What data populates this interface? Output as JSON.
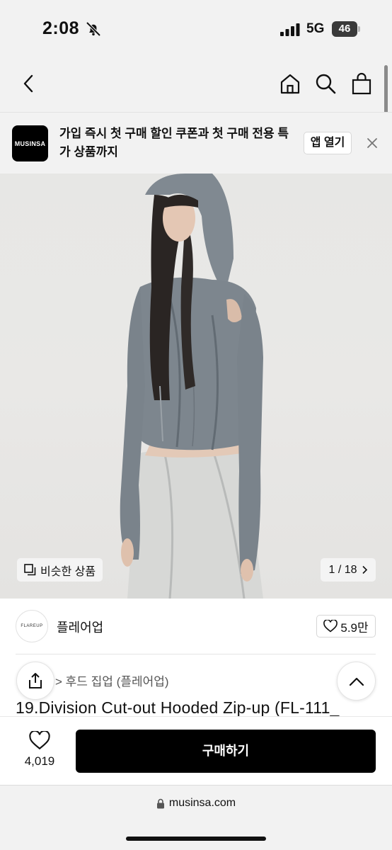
{
  "status_bar": {
    "time": "2:08",
    "network": "5G",
    "battery": "46"
  },
  "header": {
    "back_icon": "chevron-left-icon",
    "home_icon": "home-icon",
    "search_icon": "search-icon",
    "cart_icon": "shopping-bag-icon"
  },
  "app_banner": {
    "logo_text": "MUSINSA",
    "message": "가입 즉시 첫 구매 할인 쿠폰과 첫 구매 전용 특가 상품까지",
    "open_app_label": "앱 열기"
  },
  "gallery": {
    "similar_label": "비슷한 상품",
    "page_current": "1",
    "page_total": "18",
    "page_label": "1 / 18"
  },
  "brand": {
    "logo_text": "FLAREUP",
    "name": "플레어업",
    "likes": "5.9만"
  },
  "product": {
    "category": "> 후드 집업 (플레어업)",
    "title": "19.Division Cut-out Hooded Zip-up (FL-111_"
  },
  "buy_bar": {
    "wish_count": "4,019",
    "buy_label": "구매하기"
  },
  "browser": {
    "url": "musinsa.com"
  },
  "colors": {
    "background": "#ffffff",
    "chrome_gray": "#f2f2f2",
    "buy_button": "#000000",
    "jacket_gray": "#7d868e"
  }
}
